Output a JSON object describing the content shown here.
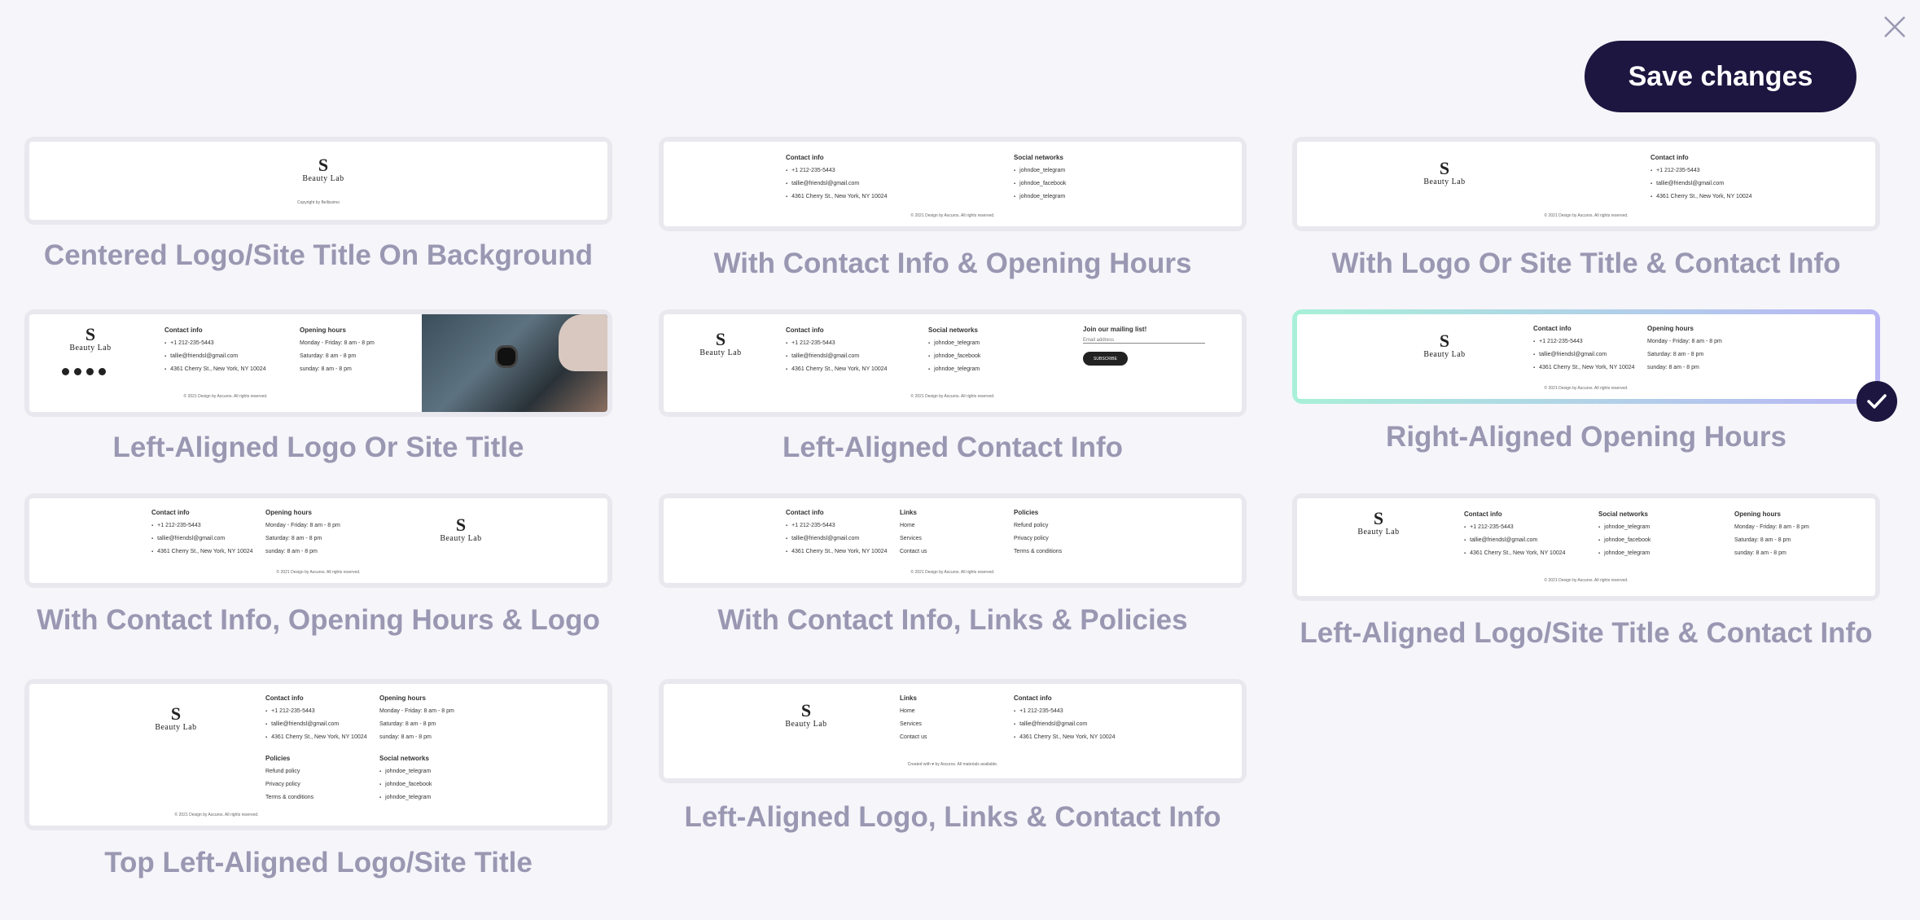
{
  "header": {
    "save_label": "Save changes"
  },
  "mini": {
    "brand": "Beauty Lab",
    "brand_mark": "S",
    "copyright": "© 2021 Design by Ascuros. All rights reserved.",
    "copyright_short": "Copyright by Bellissimo",
    "created": "Created with ♥ by Ascuros. All materials available.",
    "contact_h": "Contact info",
    "phone": "+1 212-235-5443",
    "email": "tallie@friendsl@gmail.com",
    "address": "4361 Cherry St., New York, NY 10024",
    "hours_h": "Opening hours",
    "h1": "Monday - Friday: 8 am - 8 pm",
    "h2": "Saturday: 8 am - 8 pm",
    "h3": "sunday: 8 am - 8 pm",
    "social_h": "Social networks",
    "s1": "johndoe_telegram",
    "s2": "johndoe_facebook",
    "s3": "johndoe_telegram",
    "links_h": "Links",
    "l1": "Home",
    "l2": "Services",
    "l3": "Contact us",
    "pol_h": "Policies",
    "p1": "Refund policy",
    "p2": "Privacy policy",
    "p3": "Terms & conditions",
    "mail_h": "Join our mailing list!",
    "mail_ph": "Email address",
    "mail_btn": "SUBSCRIBE"
  },
  "layouts": [
    {
      "label": "Centered Logo/Site Title On Background"
    },
    {
      "label": "With Contact Info & Opening Hours"
    },
    {
      "label": "With Logo Or Site Title & Contact Info"
    },
    {
      "label": "Left-Aligned Logo Or Site Title"
    },
    {
      "label": "Left-Aligned Contact Info"
    },
    {
      "label": "Right-Aligned Opening Hours",
      "selected": true
    },
    {
      "label": "With Contact Info, Opening Hours & Logo"
    },
    {
      "label": "With Contact Info, Links & Policies"
    },
    {
      "label": "Left-Aligned Logo/Site Title & Contact Info"
    },
    {
      "label": "Top Left-Aligned Logo/Site Title"
    },
    {
      "label": "Left-Aligned Logo, Links & Contact Info"
    }
  ],
  "colors": {
    "accent": "#1c1640",
    "label": "#9a97b2",
    "background": "#f5f5fa"
  }
}
